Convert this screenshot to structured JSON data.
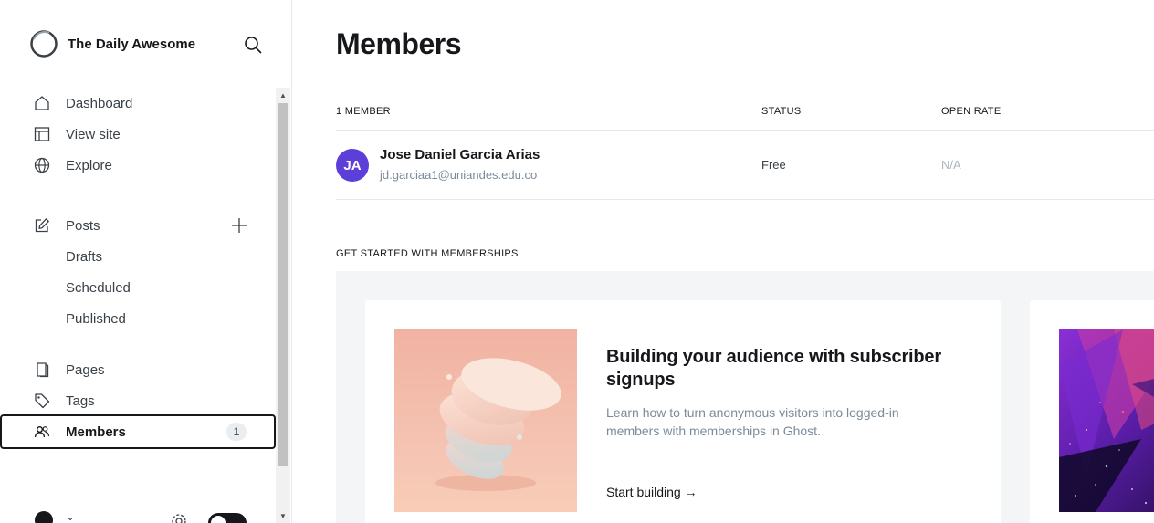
{
  "sidebar": {
    "site_name": "The Daily Awesome",
    "nav": {
      "dashboard": "Dashboard",
      "view_site": "View site",
      "explore": "Explore",
      "posts": "Posts",
      "drafts": "Drafts",
      "scheduled": "Scheduled",
      "published": "Published",
      "pages": "Pages",
      "tags": "Tags",
      "members": "Members",
      "members_count": "1"
    },
    "user_chevron": "⌄"
  },
  "main": {
    "title": "Members",
    "table": {
      "headers": {
        "member": "1 MEMBER",
        "status": "STATUS",
        "open_rate": "OPEN RATE"
      },
      "rows": [
        {
          "initials": "JA",
          "name": "Jose Daniel Garcia Arias",
          "email": "jd.garciaa1@uniandes.edu.co",
          "status": "Free",
          "open_rate": "N/A"
        }
      ]
    },
    "get_started": {
      "heading": "GET STARTED WITH MEMBERSHIPS",
      "cards": [
        {
          "title": "Building your audience with subscriber signups",
          "description": "Learn how to turn anonymous visitors into logged-in members with memberships in Ghost.",
          "link": "Start building →"
        }
      ]
    }
  },
  "colors": {
    "avatar": "#5b3fd8",
    "accent_dark": "#15171a",
    "muted_text": "#7c8b9a"
  }
}
